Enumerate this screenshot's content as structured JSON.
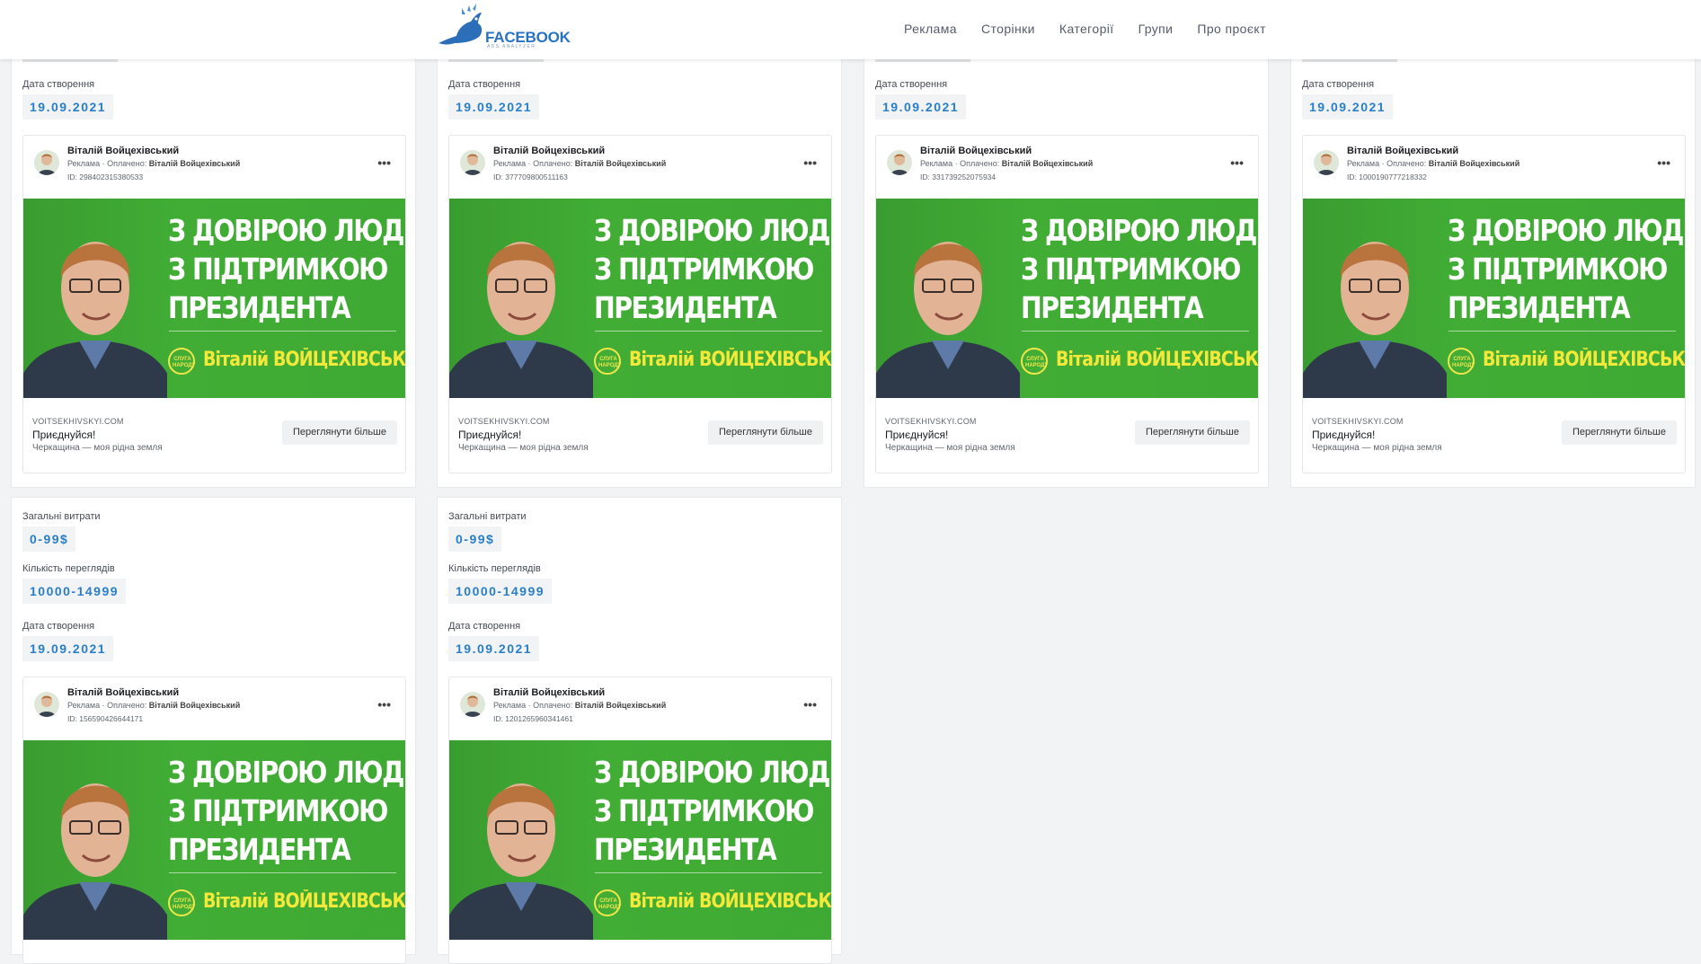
{
  "header": {
    "logo_text": "FACEBOOK",
    "logo_sub": "ADS ANALYZER",
    "nav": [
      "Реклама",
      "Сторінки",
      "Категорії",
      "Групи",
      "Про проєкт"
    ]
  },
  "labels": {
    "spend": "Загальні витрати",
    "views": "Кількість переглядів",
    "created": "Дата створення"
  },
  "ad_common": {
    "page_name": "Віталій Войцехівський",
    "meta_prefix": "Реклама · Оплачено: ",
    "payer": "Віталій Войцехівський",
    "dots": "•••",
    "banner_line1": "З ДОВІРОЮ ЛЮДЕЙ,",
    "banner_line2": "З ПІДТРИМКОЮ",
    "banner_line3": "ПРЕЗИДЕНТА",
    "banner_party": "СЛУГА НАРОДУ",
    "banner_name": "Віталій ВОЙЦЕХІВСЬКИЙ",
    "domain": "VOITSEKHIVSKYI.COM",
    "title": "Приєднуйся!",
    "description": "Черкащина — моя рідна земля",
    "cta": "Переглянути більше"
  },
  "cards": [
    {
      "created": "19.09.2021",
      "ad_id": "ID: 298402315380533"
    },
    {
      "created": "19.09.2021",
      "ad_id": "ID: 377709800511163"
    },
    {
      "created": "19.09.2021",
      "ad_id": "ID: 331739252075934"
    },
    {
      "created": "19.09.2021",
      "ad_id": "ID: 1000190777218332"
    },
    {
      "spend": "0-99$",
      "views": "10000-14999",
      "created": "19.09.2021",
      "ad_id": "ID: 156590426644171"
    },
    {
      "spend": "0-99$",
      "views": "10000-14999",
      "created": "19.09.2021",
      "ad_id": "ID: 1201265960341461"
    }
  ],
  "colors": {
    "accent": "#2a7fc8",
    "banner_green": "#3eaa33",
    "banner_yellow": "#f4e83a"
  }
}
